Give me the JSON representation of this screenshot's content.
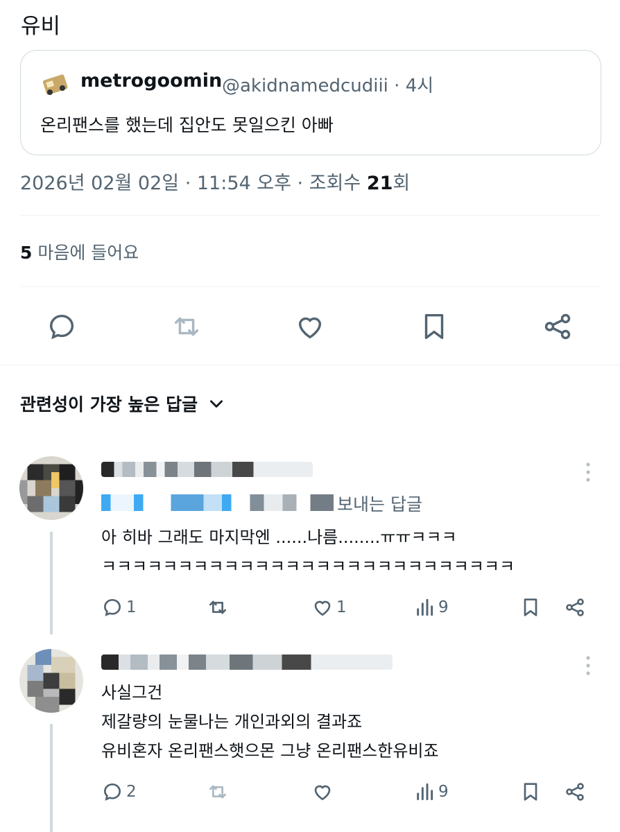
{
  "post": {
    "text": "유비",
    "quote": {
      "name": "metrogoomin",
      "handle": "@akidnamedcudiii",
      "time": "· 4시",
      "body": "온리팬스를 했는데 집안도 못일으킨 아빠"
    },
    "meta": {
      "date": "2026년 02월 02일",
      "time": "· 11:54 오후 ·",
      "views_label": "조회수",
      "views_count": "21",
      "views_suffix": "회"
    },
    "likes": {
      "count": "5",
      "label": "마음에 들어요"
    },
    "actions": [
      "reply-icon",
      "retweet-icon",
      "heart-icon",
      "bookmark-icon",
      "share-icon"
    ]
  },
  "sort": {
    "label": "관련성이 가장 높은 답글"
  },
  "replies": [
    {
      "to_label": "보내는 답글",
      "text_lines": [
        "아 히바 그래도 마지막엔 ......나름........ㅠㅠㅋㅋㅋ",
        "ㅋㅋㅋㅋㅋㅋㅋㅋㅋㅋㅋㅋㅋㅋㅋㅋㅋㅋㅋㅋㅋㅋㅋㅋㅋㅋㅋ"
      ],
      "reply_count": "1",
      "retweet_count": "",
      "like_count": "1",
      "view_count": "9"
    },
    {
      "text_lines": [
        "사실그건",
        "제갈량의 눈물나는 개인과외의 결과죠",
        "유비혼자 온리팬스햇으몬 그냥 온리팬스한유비죠"
      ],
      "reply_count": "2",
      "retweet_count": "",
      "like_count": "",
      "view_count": "9"
    }
  ],
  "colors": {
    "text": "#0f1419",
    "secondary": "#536471",
    "border": "#cfd9de",
    "accent": "#1d9bf0"
  }
}
